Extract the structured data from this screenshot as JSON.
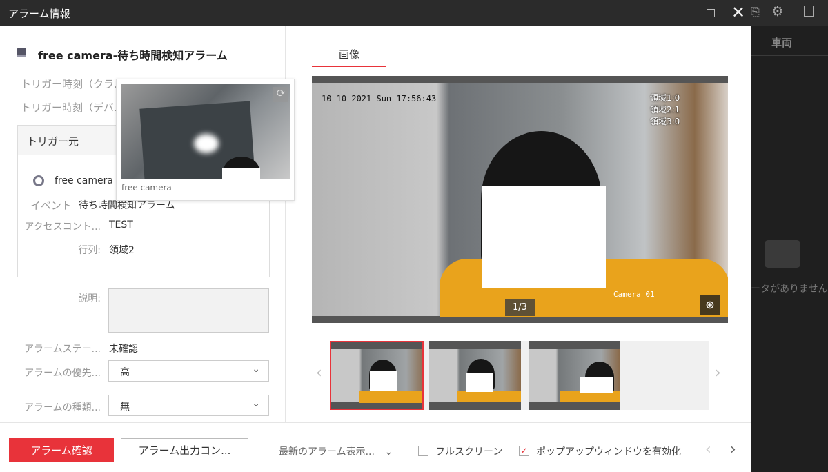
{
  "window": {
    "title": "アラーム情報"
  },
  "header": {
    "title": "free camera-待ち時間検知アラーム"
  },
  "trigger_times": [
    {
      "label": "トリガー時刻（クラ..."
    },
    {
      "label": "トリガー時刻（デバ..."
    }
  ],
  "popup": {
    "caption": "free camera"
  },
  "source": {
    "header": "トリガー元",
    "camera": "free camera",
    "fields": [
      {
        "label": "イベント",
        "value": "待ち時間検知アラーム"
      },
      {
        "label": "アクセスコント...",
        "value": "TEST"
      },
      {
        "label": "行列:",
        "value": "領域2"
      }
    ]
  },
  "form": {
    "description_label": "説明:",
    "description_value": "",
    "status_label": "アラームステー...",
    "status_value": "未確認",
    "priority_label": "アラームの優先...",
    "priority_value": "高",
    "type_label": "アラームの種類...",
    "type_value": "無"
  },
  "image_panel": {
    "tab": "画像",
    "osd_time": "10-10-2021 Sun 17:56:43",
    "osd_regions": [
      "領域1:0",
      "領域2:1",
      "領域3:0"
    ],
    "osd_camera": "Camera 01",
    "counter": "1/3",
    "thumbnails": 3,
    "selected_thumbnail": 1
  },
  "footer": {
    "confirm": "アラーム確認",
    "output": "アラーム出力コン...",
    "latest": "最新のアラーム表示...",
    "fullscreen": "フルスクリーン",
    "fullscreen_checked": false,
    "popup": "ポップアップウィンドウを有効化",
    "popup_checked": true
  },
  "right_panel": {
    "tab": "車両",
    "empty": "ータがありません"
  },
  "colors": {
    "accent": "#e8333a",
    "titlebar": "#2b2b2b"
  }
}
